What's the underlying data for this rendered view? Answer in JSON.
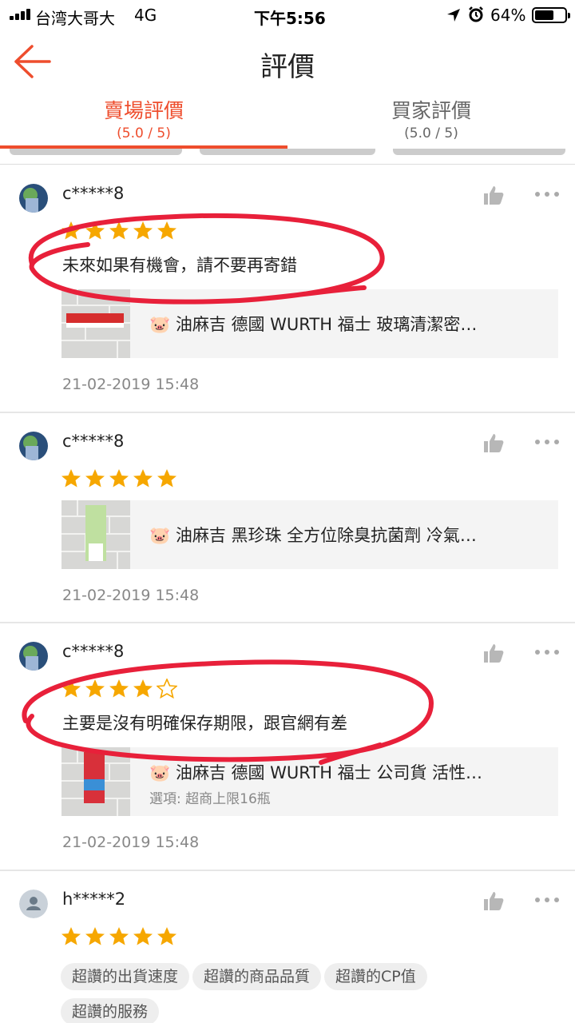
{
  "status_bar": {
    "carrier": "台湾大哥大",
    "network": "4G",
    "time": "下午5:56",
    "battery_percent": "64%",
    "battery_level": 0.64
  },
  "header": {
    "title": "評價",
    "back_icon": "back-arrow-icon"
  },
  "tabs": [
    {
      "label": "賣場評價",
      "score": "(5.0 / 5)",
      "active": true
    },
    {
      "label": "買家評價",
      "score": "(5.0 / 5)",
      "active": false
    }
  ],
  "colors": {
    "accent": "#ee4d2d",
    "star": "#f6a700",
    "annotation": "#e8203a"
  },
  "reviews": [
    {
      "user": "c*****8",
      "rating": 5,
      "comment": "未來如果有機會，請不要再寄錯",
      "product": {
        "name": "🐷 油麻吉 德國 WURTH 福士 玻璃清潔密…",
        "variant": ""
      },
      "date": "21-02-2019 15:48"
    },
    {
      "user": "c*****8",
      "rating": 5,
      "comment": "",
      "product": {
        "name": "🐷 油麻吉  黑珍珠 全方位除臭抗菌劑 冷氣…",
        "variant": ""
      },
      "date": "21-02-2019 15:48"
    },
    {
      "user": "c*****8",
      "rating": 4,
      "comment": "主要是沒有明確保存期限，跟官網有差",
      "product": {
        "name": "🐷 油麻吉 德國 WURTH 福士 公司貨 活性…",
        "variant": "選項: 超商上限16瓶"
      },
      "date": "21-02-2019 15:48"
    },
    {
      "user": "h*****2",
      "rating": 5,
      "tags": [
        "超讚的出貨速度",
        "超讚的商品品質",
        "超讚的CP值",
        "超讚的服務"
      ]
    }
  ]
}
